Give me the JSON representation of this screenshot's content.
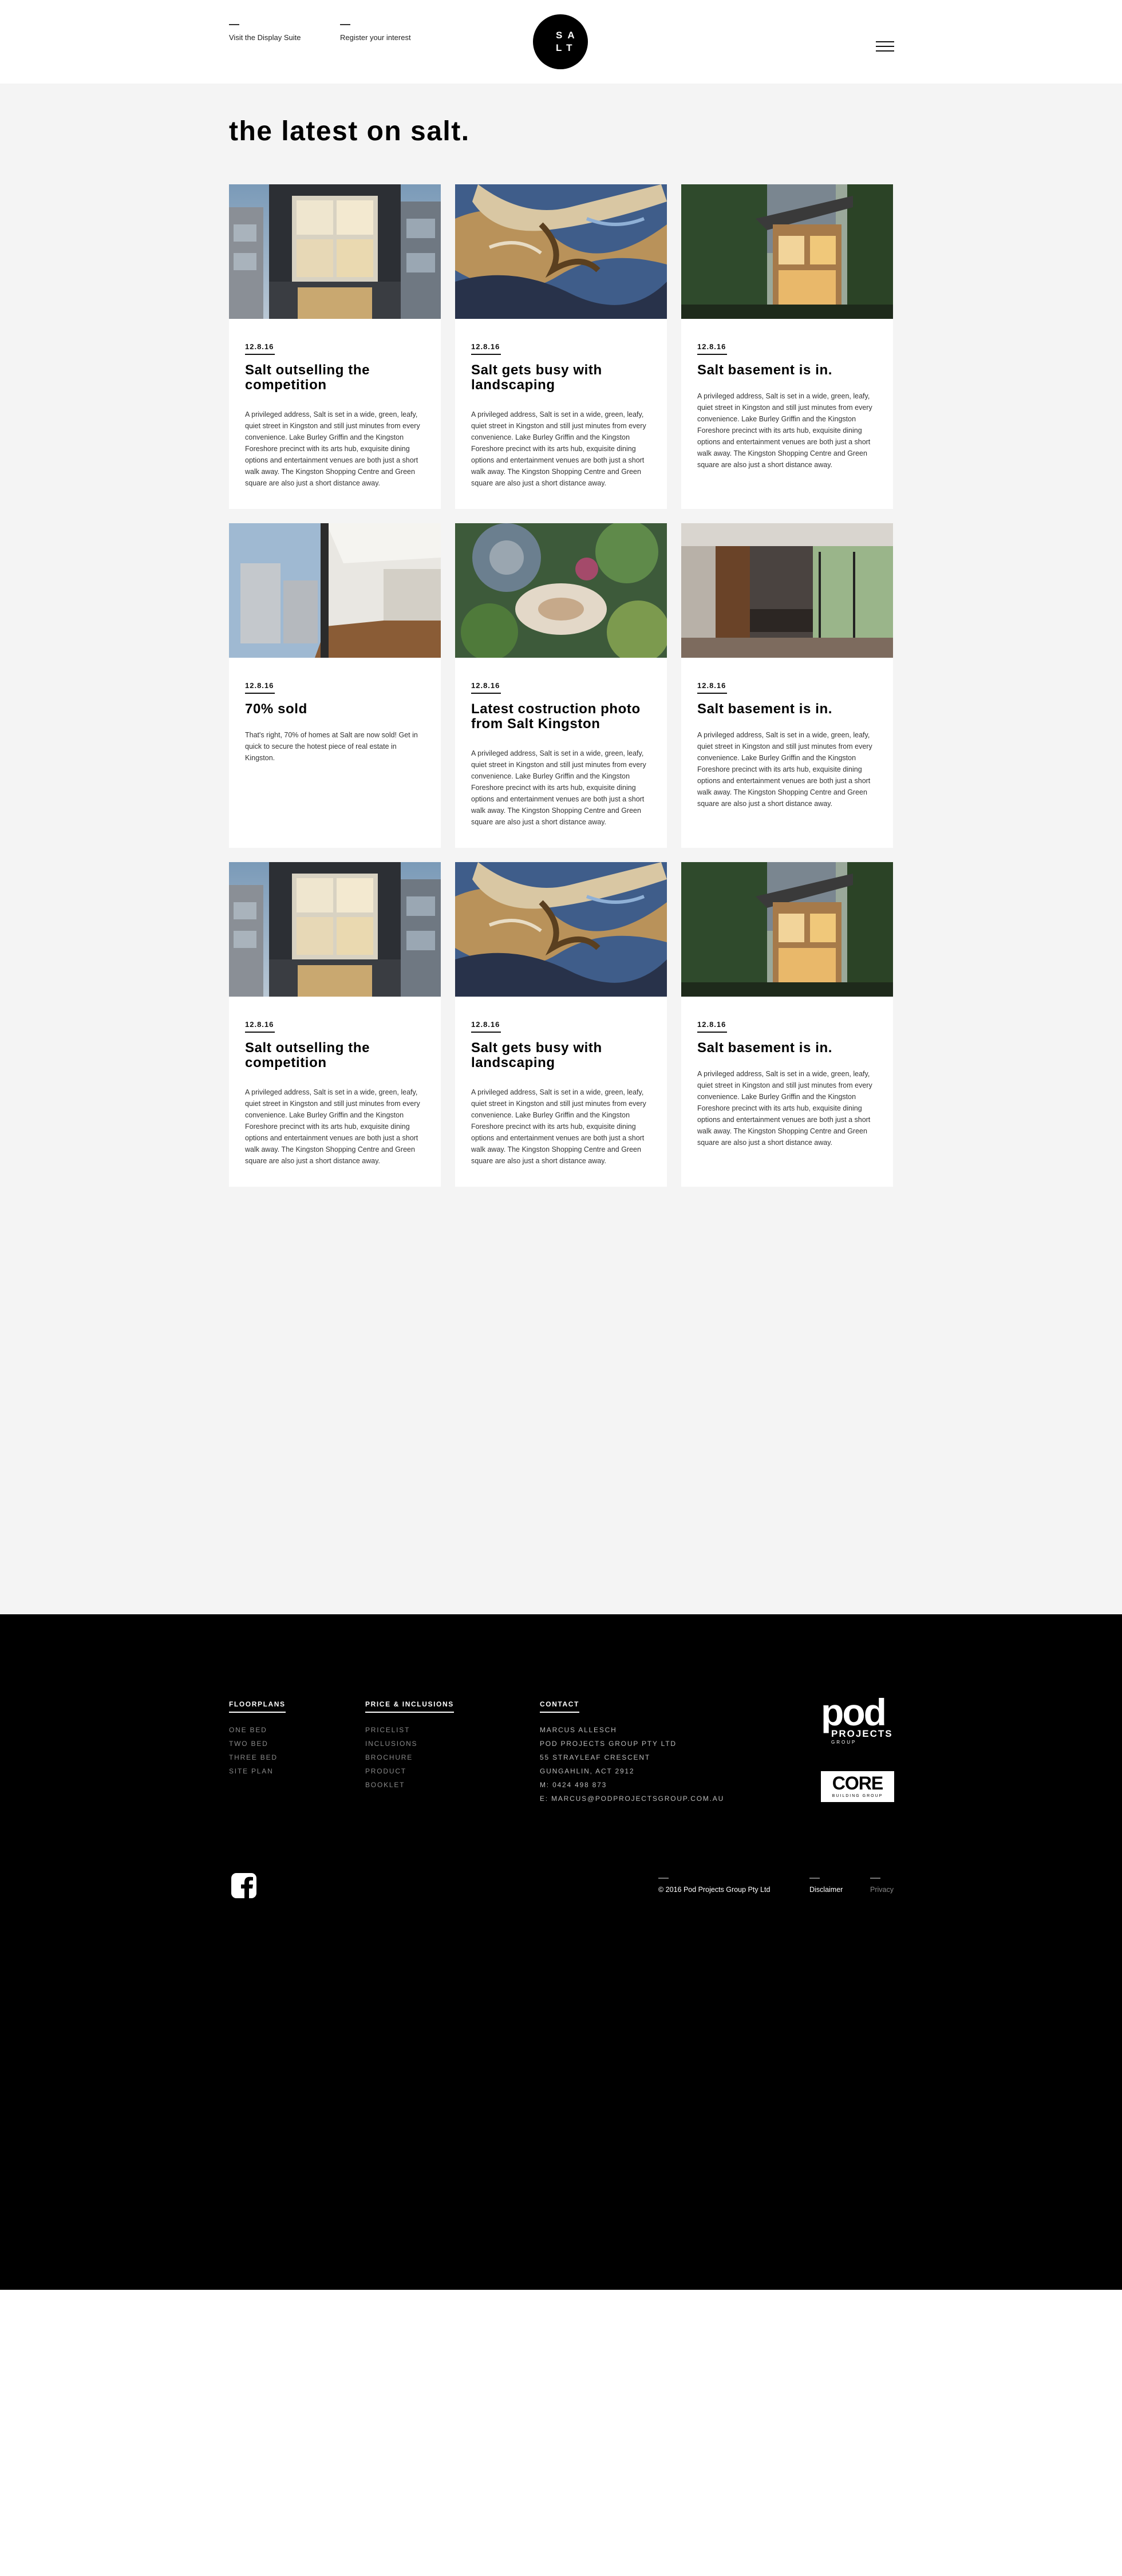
{
  "header": {
    "link_display_suite": "Visit the Display Suite",
    "link_register": "Register your  interest",
    "logo_line1": "SA",
    "logo_line2": "LT"
  },
  "main": {
    "title": "the latest on salt."
  },
  "posts": [
    {
      "date": "12.8.16",
      "title": "Salt outselling the competition",
      "body": "A privileged address, Salt is set in a wide, green, leafy, quiet street in Kingston and still just minutes from every convenience. Lake Burley Griffin and the Kingston Foreshore precinct with its arts hub, exquisite dining options and entertainment venues are both just a short walk away. The Kingston Shopping Centre and Green square are also just a short distance away."
    },
    {
      "date": "12.8.16",
      "title": "Salt gets busy with landscaping",
      "body": "A privileged address, Salt is set in a wide, green, leafy, quiet street in Kingston and still just minutes from every convenience. Lake Burley Griffin and the Kingston Foreshore precinct with its arts hub, exquisite dining options and entertainment venues are both just a short walk away. The Kingston Shopping Centre and Green square are also just a short distance away."
    },
    {
      "date": "12.8.16",
      "title": "Salt basement is in.",
      "body": "A privileged address, Salt is set in a wide, green, leafy, quiet street in Kingston and still just minutes from every convenience. Lake Burley Griffin and the Kingston Foreshore precinct with its arts hub, exquisite dining options and entertainment venues are both just a short walk away. The Kingston Shopping Centre and Green square are also just a short distance away."
    },
    {
      "date": "12.8.16",
      "title": "70% sold",
      "body": "That's right, 70% of homes at Salt are now sold! Get in quick to secure the hotest piece of real estate in Kingston."
    },
    {
      "date": "12.8.16",
      "title": "Latest costruction photo from Salt Kingston",
      "body": "A privileged address, Salt is set in a wide, green, leafy, quiet street in Kingston and still just minutes from every convenience. Lake Burley Griffin and the Kingston Foreshore precinct with its arts hub, exquisite dining options and entertainment venues are both just a short walk away. The Kingston Shopping Centre and Green square are also just a short distance away."
    },
    {
      "date": "12.8.16",
      "title": "Salt basement is in.",
      "body": "A privileged address, Salt is set in a wide, green, leafy, quiet street in Kingston and still just minutes from every convenience. Lake Burley Griffin and the Kingston Foreshore precinct with its arts hub, exquisite dining options and entertainment venues are both just a short walk away. The Kingston Shopping Centre and Green square are also just a short distance away."
    },
    {
      "date": "12.8.16",
      "title": "Salt outselling the competition",
      "body": "A privileged address, Salt is set in a wide, green, leafy, quiet street in Kingston and still just minutes from every convenience. Lake Burley Griffin and the Kingston Foreshore precinct with its arts hub, exquisite dining options and entertainment venues are both just a short walk away. The Kingston Shopping Centre and Green square are also just a short distance away."
    },
    {
      "date": "12.8.16",
      "title": "Salt gets busy with landscaping",
      "body": "A privileged address, Salt is set in a wide, green, leafy, quiet street in Kingston and still just minutes from every convenience. Lake Burley Griffin and the Kingston Foreshore precinct with its arts hub, exquisite dining options and entertainment venues are both just a short walk away. The Kingston Shopping Centre and Green square are also just a short distance away."
    },
    {
      "date": "12.8.16",
      "title": "Salt basement is in.",
      "body": "A privileged address, Salt is set in a wide, green, leafy, quiet street in Kingston and still just minutes from every convenience. Lake Burley Griffin and the Kingston Foreshore precinct with its arts hub, exquisite dining options and entertainment venues are both just a short walk away. The Kingston Shopping Centre and Green square are also just a short distance away."
    }
  ],
  "footer": {
    "floorplans": {
      "heading": "FLOORPLANS",
      "items": [
        "ONE BED",
        "TWO BED",
        "THREE BED",
        "SITE PLAN"
      ]
    },
    "price": {
      "heading": "PRICE & INCLUSIONS",
      "items": [
        "PRICELIST",
        "INCLUSIONS",
        "BROCHURE",
        "PRODUCT",
        "BOOKLET"
      ]
    },
    "contact": {
      "heading": "CONTACT",
      "items": [
        "MARCUS ALLESCH",
        "POD PROJECTS GROUP PTY LTD",
        "55 STRAYLEAF CRESCENT",
        "GUNGAHLIN, ACT 2912",
        "M: 0424 498 873",
        "E: MARCUS@PODPROJECTSGROUP.COM.AU"
      ]
    },
    "pod_logo": {
      "word": "pod",
      "line1": "PROJECTS",
      "line2": "GROUP"
    },
    "core_logo": {
      "word": "CORE",
      "tag": "BUILDING GROUP"
    },
    "copyright": "© 2016 Pod Projects Group Pty Ltd",
    "disclaimer": "Disclaimer",
    "privacy": "Privacy"
  }
}
